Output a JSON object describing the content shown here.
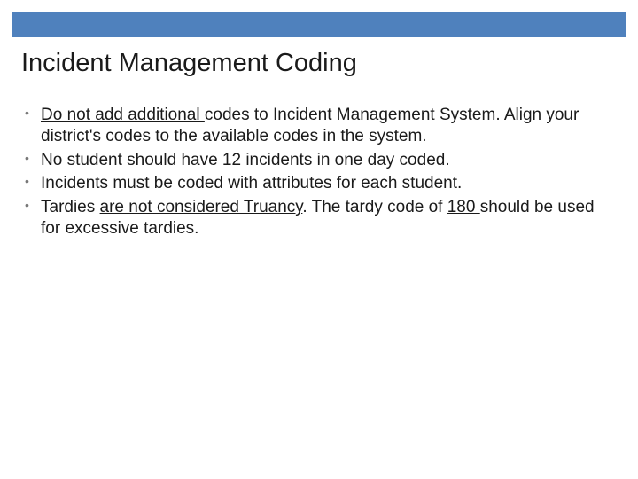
{
  "title": "Incident Management Coding",
  "bullets": {
    "b1": {
      "u1": "Do not add additional ",
      "t1": "codes to Incident Management System. Align your district's codes to the available codes in the system."
    },
    "b2": {
      "t": "No student should have 12 incidents in one day coded."
    },
    "b3": {
      "t": "Incidents must be coded with attributes for each student."
    },
    "b4": {
      "t1": "Tardies ",
      "u1": "are not considered Truancy",
      "t2": ". The tardy code of ",
      "u2": "180 ",
      "t3": "should be used for excessive tardies."
    }
  }
}
